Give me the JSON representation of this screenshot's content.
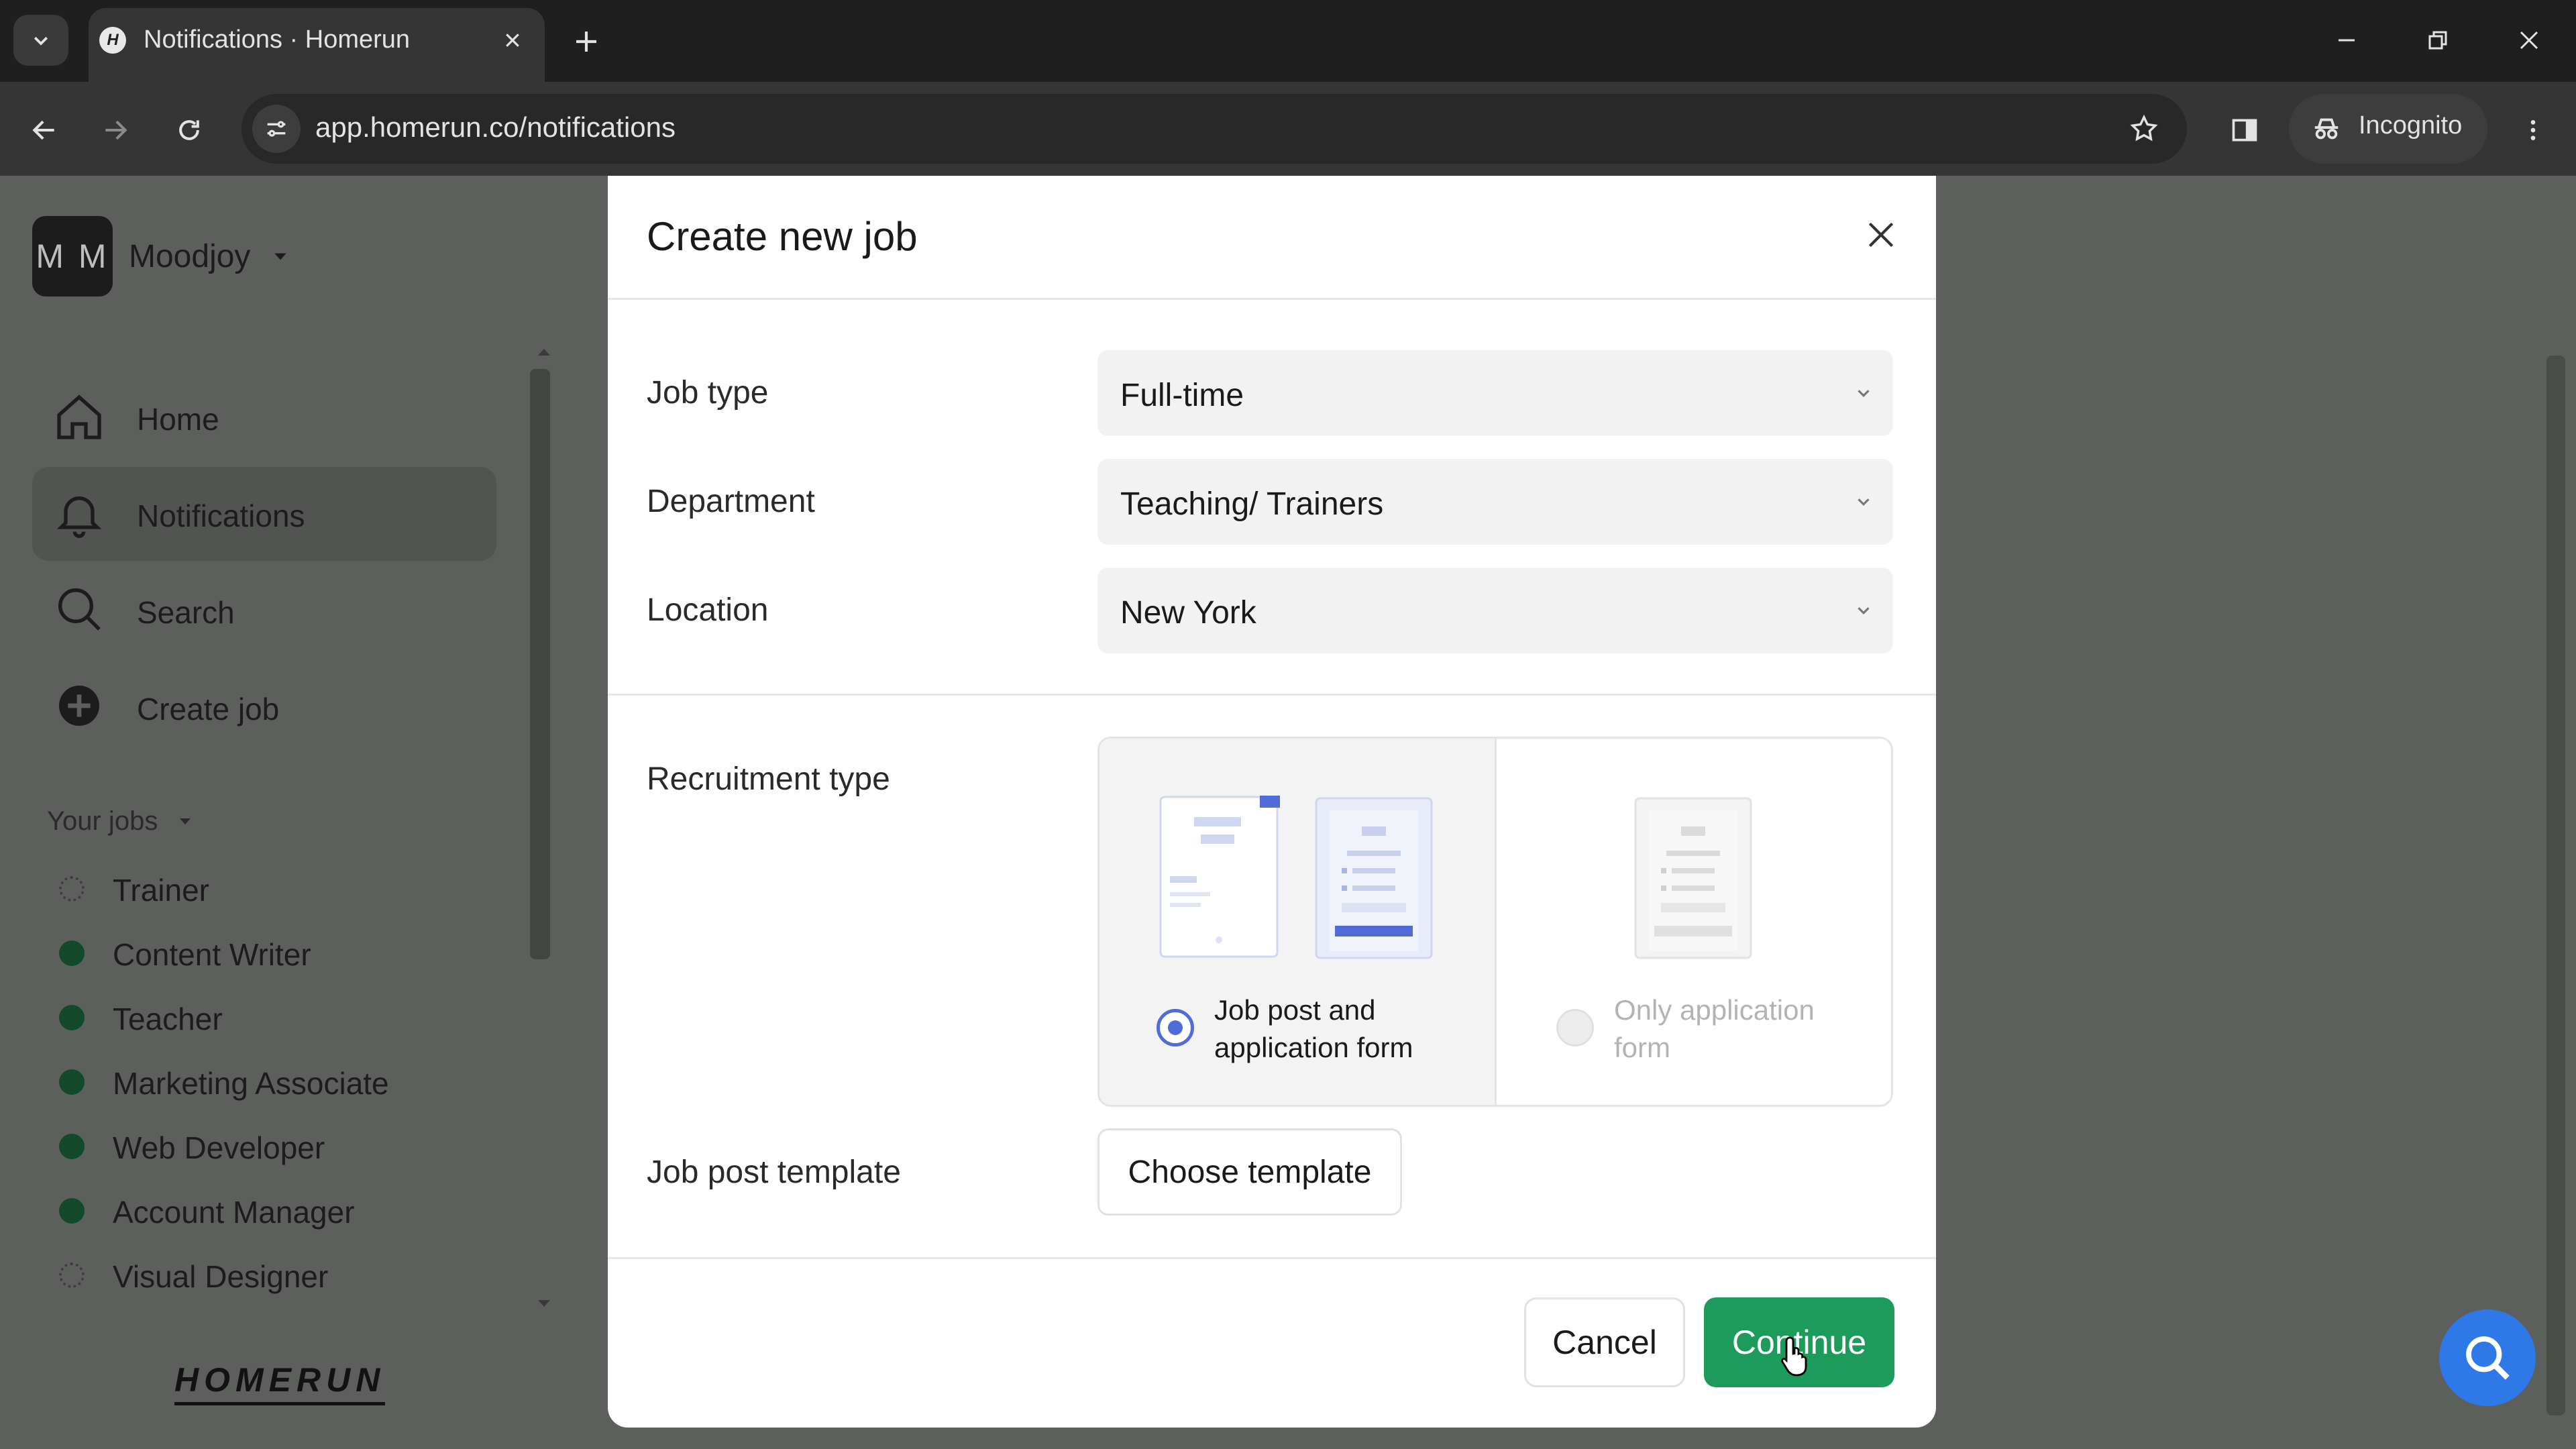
{
  "browser": {
    "tab_title": "Notifications · Homerun",
    "tab_favicon": "H",
    "url": "app.homerun.co/notifications",
    "incognito_label": "Incognito"
  },
  "sidebar": {
    "avatar_initials": "M M",
    "workspace_name": "Moodjoy",
    "nav": [
      {
        "label": "Home",
        "icon": "home-icon"
      },
      {
        "label": "Notifications",
        "icon": "bell-icon"
      },
      {
        "label": "Search",
        "icon": "search-icon"
      },
      {
        "label": "Create job",
        "icon": "plus-circle-icon"
      }
    ],
    "your_jobs_label": "Your jobs",
    "jobs": [
      {
        "label": "Trainer",
        "status": "draft"
      },
      {
        "label": "Content Writer",
        "status": "active"
      },
      {
        "label": "Teacher",
        "status": "active"
      },
      {
        "label": "Marketing Associate",
        "status": "active"
      },
      {
        "label": "Web Developer",
        "status": "active"
      },
      {
        "label": "Account Manager",
        "status": "active"
      },
      {
        "label": "Visual Designer",
        "status": "draft"
      }
    ],
    "logo_text": "HOMERUN"
  },
  "modal": {
    "title": "Create new job",
    "fields": {
      "job_type": {
        "label": "Job type",
        "value": "Full-time"
      },
      "department": {
        "label": "Department",
        "value": "Teaching/ Trainers"
      },
      "location": {
        "label": "Location",
        "value": "New York"
      }
    },
    "recruitment_type": {
      "label": "Recruitment type",
      "options": [
        {
          "label": "Job post and application form",
          "selected": true
        },
        {
          "label": "Only application form",
          "selected": false
        }
      ]
    },
    "job_post_template": {
      "label": "Job post template",
      "button": "Choose template"
    },
    "cancel_label": "Cancel",
    "continue_label": "Continue"
  },
  "colors": {
    "accent_green": "#1d9b5a",
    "radio_blue": "#4f6cd8",
    "help_blue": "#2f78e8",
    "overlay": "#5c5f5c"
  }
}
